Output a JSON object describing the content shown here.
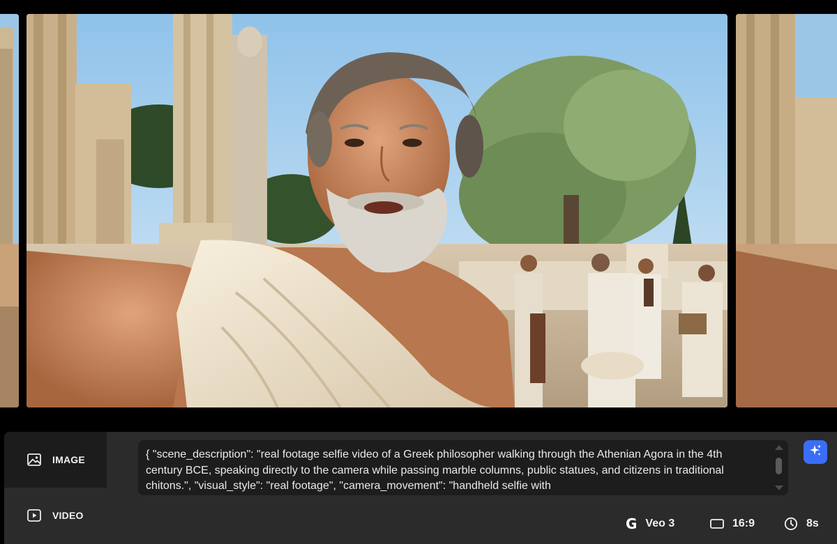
{
  "modes": [
    {
      "label": "IMAGE",
      "icon": "image-icon",
      "active": true
    },
    {
      "label": "VIDEO",
      "icon": "play-square-icon",
      "active": false
    }
  ],
  "prompt": {
    "text": "{ \"scene_description\": \"real footage selfie video of a Greek philosopher walking through the Athenian Agora in the 4th century BCE, speaking directly to the camera while passing marble columns, public statues, and citizens in traditional chitons.\", \"visual_style\": \"real footage\", \"camera_movement\": \"handheld selfie with"
  },
  "settings": {
    "model": {
      "label": "Veo 3",
      "icon": "google-g-icon"
    },
    "aspect_ratio": {
      "label": "16:9",
      "icon": "aspect-ratio-icon"
    },
    "duration": {
      "label": "8s",
      "icon": "clock-icon"
    }
  },
  "colors": {
    "accent": "#3b6ef8",
    "panel_bg": "#2b2b2c",
    "prompt_bg": "#1d1d1e"
  }
}
